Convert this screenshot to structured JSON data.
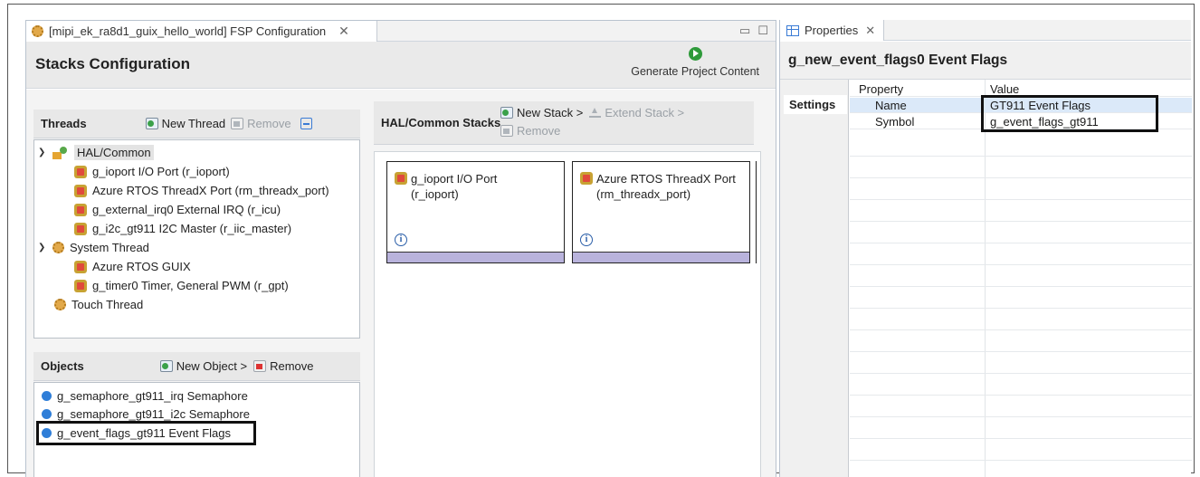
{
  "editor": {
    "tab_title": "[mipi_ek_ra8d1_guix_hello_world] FSP Configuration",
    "tab_close": "✕",
    "header_title": "Stacks Configuration",
    "generate_label": "Generate Project Content"
  },
  "threads": {
    "title": "Threads",
    "new_thread": "New Thread",
    "remove": "Remove",
    "items": [
      {
        "label": "HAL/Common"
      },
      {
        "label": "g_ioport I/O Port (r_ioport)"
      },
      {
        "label": "Azure RTOS ThreadX Port (rm_threadx_port)"
      },
      {
        "label": "g_external_irq0 External IRQ (r_icu)"
      },
      {
        "label": "g_i2c_gt911 I2C Master (r_iic_master)"
      },
      {
        "label": "System Thread"
      },
      {
        "label": "Azure RTOS GUIX"
      },
      {
        "label": "g_timer0 Timer, General PWM (r_gpt)"
      },
      {
        "label": "Touch Thread"
      }
    ]
  },
  "objects": {
    "title": "Objects",
    "new_object": "New Object >",
    "remove": "Remove",
    "items": [
      {
        "label": "g_semaphore_gt911_irq Semaphore"
      },
      {
        "label": "g_semaphore_gt911_i2c Semaphore"
      },
      {
        "label": "g_event_flags_gt911 Event Flags"
      }
    ]
  },
  "stacks": {
    "title": "HAL/Common Stacks",
    "new_stack": "New Stack >",
    "extend_stack": "Extend Stack >",
    "remove": "Remove",
    "cards": [
      {
        "line1": "g_ioport I/O Port",
        "line2": "(r_ioport)"
      },
      {
        "line1": "Azure RTOS ThreadX Port",
        "line2": "(rm_threadx_port)"
      }
    ]
  },
  "properties": {
    "tab_title": "Properties",
    "tab_close": "✕",
    "title": "g_new_event_flags0 Event Flags",
    "settings_label": "Settings",
    "col_property": "Property",
    "col_value": "Value",
    "rows": [
      {
        "property": "Name",
        "value": "GT911 Event Flags"
      },
      {
        "property": "Symbol",
        "value": "g_event_flags_gt911"
      }
    ]
  },
  "colors": {
    "card_bar": "#b9b3dc",
    "selection_row": "#dbe9f9",
    "generate_icon": "#2e9a3a"
  }
}
